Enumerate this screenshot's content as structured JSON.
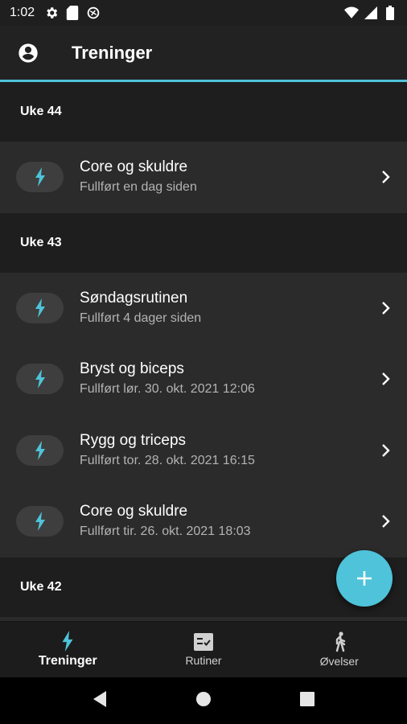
{
  "status_bar": {
    "time": "1:02",
    "icons_left": [
      "settings-icon",
      "sim-card-icon",
      "data-saver-icon"
    ],
    "icons_right": [
      "wifi-icon",
      "signal-icon",
      "battery-icon"
    ]
  },
  "app_bar": {
    "title": "Treninger",
    "account_icon": "account-circle-icon"
  },
  "colors": {
    "accent": "#4ec3d9",
    "background": "#1a1a1a",
    "card": "#2b2b2b"
  },
  "weeks": [
    {
      "label": "Uke 44",
      "workouts": [
        {
          "title": "Core og skuldre",
          "subtitle": "Fullført en dag siden"
        }
      ]
    },
    {
      "label": "Uke 43",
      "workouts": [
        {
          "title": "Søndagsrutinen",
          "subtitle": "Fullført 4 dager siden"
        },
        {
          "title": "Bryst og biceps",
          "subtitle": "Fullført lør. 30. okt. 2021 12:06"
        },
        {
          "title": "Rygg og triceps",
          "subtitle": "Fullført tor. 28. okt. 2021 16:15"
        },
        {
          "title": "Core og skuldre",
          "subtitle": "Fullført tir. 26. okt. 2021 18:03"
        }
      ]
    },
    {
      "label": "Uke 42",
      "workouts": []
    }
  ],
  "fab": {
    "icon": "plus-icon"
  },
  "bottom_nav": {
    "items": [
      {
        "label": "Treninger",
        "icon": "bolt-icon",
        "active": true
      },
      {
        "label": "Rutiner",
        "icon": "checklist-icon",
        "active": false
      },
      {
        "label": "Øvelser",
        "icon": "walking-icon",
        "active": false
      }
    ]
  },
  "system_nav": [
    "back-icon",
    "home-icon",
    "recents-icon"
  ]
}
